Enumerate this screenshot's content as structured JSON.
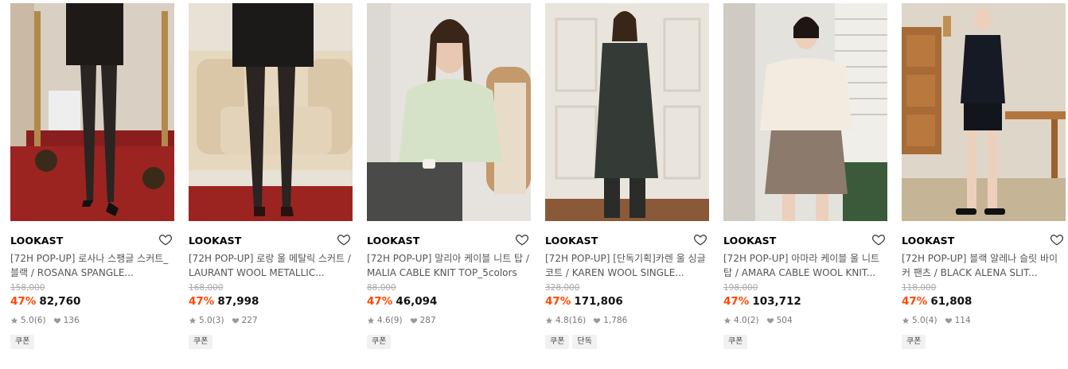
{
  "products": [
    {
      "brand": "LOOKAST",
      "title": "[72H POP-UP] 로사나 스팽글 스커트_블랙 / ROSANA SPANGLE...",
      "original_price": "158,000",
      "discount": "47%",
      "price": "82,760",
      "rating": "5.0",
      "reviews": "(6)",
      "likes": "136",
      "tags": [
        "쿠폰"
      ]
    },
    {
      "brand": "LOOKAST",
      "title": "[72H POP-UP] 로랑 울 메탈릭 스커트 / LAURANT WOOL METALLIC...",
      "original_price": "168,000",
      "discount": "47%",
      "price": "87,998",
      "rating": "5.0",
      "reviews": "(3)",
      "likes": "227",
      "tags": [
        "쿠폰"
      ]
    },
    {
      "brand": "LOOKAST",
      "title": "[72H POP-UP] 말리아 케이블 니트 탑 / MALIA CABLE KNIT TOP_5colors",
      "original_price": "88,000",
      "discount": "47%",
      "price": "46,094",
      "rating": "4.6",
      "reviews": "(9)",
      "likes": "287",
      "tags": [
        "쿠폰"
      ]
    },
    {
      "brand": "LOOKAST",
      "title": "[72H POP-UP] [단독기획]카렌 울 싱글 코트 / KAREN WOOL SINGLE...",
      "original_price": "328,000",
      "discount": "47%",
      "price": "171,806",
      "rating": "4.8",
      "reviews": "(16)",
      "likes": "1,786",
      "tags": [
        "쿠폰",
        "단독"
      ]
    },
    {
      "brand": "LOOKAST",
      "title": "[72H POP-UP] 아마라 케이블 울 니트 탑 / AMARA CABLE WOOL KNIT...",
      "original_price": "198,000",
      "discount": "47%",
      "price": "103,712",
      "rating": "4.0",
      "reviews": "(2)",
      "likes": "504",
      "tags": [
        "쿠폰"
      ]
    },
    {
      "brand": "LOOKAST",
      "title": "[72H POP-UP] 블랙 알레나 슬릿 바이커 팬츠 / BLACK ALENA SLIT...",
      "original_price": "118,000",
      "discount": "47%",
      "price": "61,808",
      "rating": "5.0",
      "reviews": "(4)",
      "likes": "114",
      "tags": [
        "쿠폰"
      ]
    }
  ],
  "colors": {
    "discount": "#ff4800",
    "meta": "#777777",
    "tag_bg": "#f1f1f1"
  }
}
